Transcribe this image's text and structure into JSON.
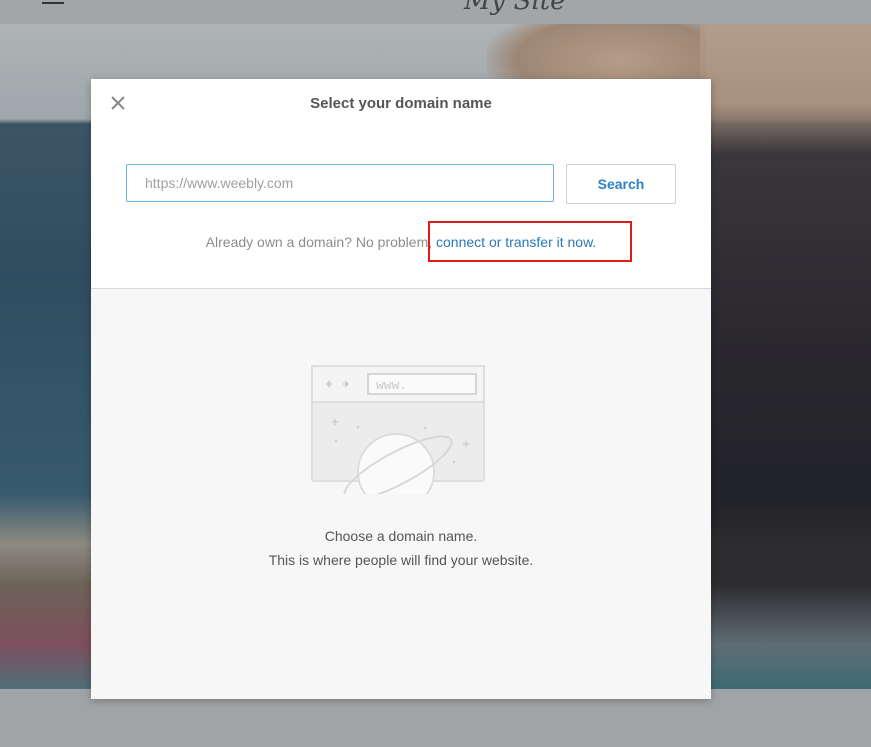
{
  "site": {
    "title": "My Site"
  },
  "modal": {
    "title": "Select your domain name",
    "close_icon": "close-icon",
    "search": {
      "value": "",
      "placeholder": "https://www.weebly.com",
      "button_label": "Search"
    },
    "help": {
      "prefix": "Already own a domain? No problem, ",
      "link_label": "connect or transfer it now."
    },
    "illustration": {
      "url_text": "www.",
      "icon": "browser-planet-illustration"
    },
    "empty_state": {
      "line1": "Choose a domain name.",
      "line2": "This is where people will find your website."
    }
  },
  "colors": {
    "accent": "#2a84c6",
    "link": "#2a78b8",
    "highlight_box": "#e01b1b",
    "input_border": "#6cb6e0"
  }
}
